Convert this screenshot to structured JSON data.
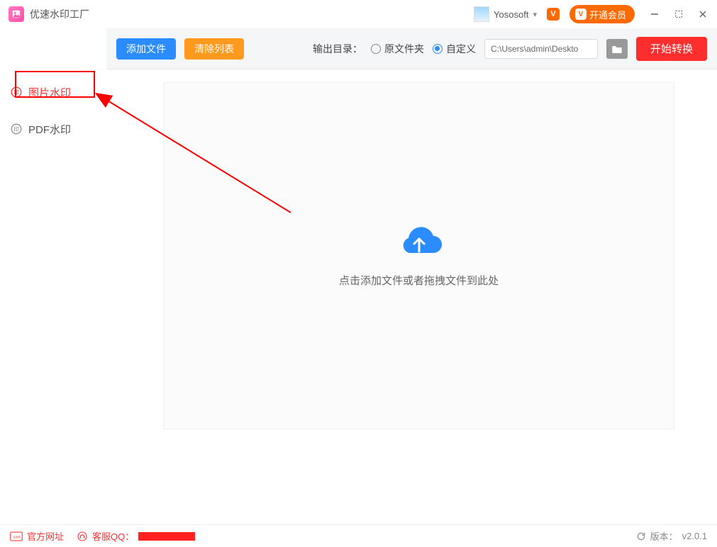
{
  "app": {
    "title": "优速水印工厂"
  },
  "header": {
    "username": "Yososoft",
    "vip_button": "开通会员"
  },
  "sidebar": {
    "items": [
      {
        "label": "图片水印",
        "icon": "stamp-icon"
      },
      {
        "label": "PDF水印",
        "icon": "stamp-icon"
      }
    ],
    "active_index": 0
  },
  "toolbar": {
    "add_files": "添加文件",
    "clear_list": "清除列表",
    "output_label": "输出目录：",
    "radio_source": "原文件夹",
    "radio_custom": "自定义",
    "radio_selected": "custom",
    "path_value": "C:\\Users\\admin\\Deskto",
    "start_button": "开始转换"
  },
  "dropzone": {
    "hint": "点击添加文件或者拖拽文件到此处"
  },
  "footer": {
    "official_site": "官方网址",
    "service_qq": "客服QQ：",
    "version_label": "版本：",
    "version_value": "v2.0.1"
  }
}
